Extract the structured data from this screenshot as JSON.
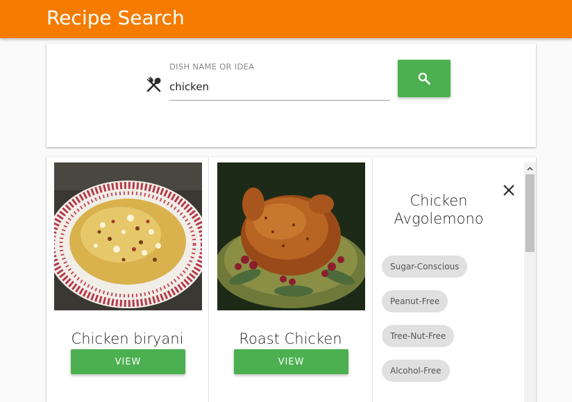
{
  "app": {
    "title": "Recipe Search",
    "accent_color": "#f57c00",
    "button_color": "#4caf50"
  },
  "search": {
    "label": "DISH NAME OR IDEA",
    "value": "chicken",
    "icon": "utensils-icon",
    "button_icon": "search-icon"
  },
  "results": [
    {
      "name": "Chicken biryani",
      "view_label": "VIEW",
      "image": "plate of chicken biryani rice"
    },
    {
      "name": "Roast Chicken",
      "view_label": "VIEW",
      "image": "whole roast chicken with grapes and herbs"
    }
  ],
  "detail": {
    "title": "Chicken Avgolemono",
    "close_icon": "close-icon",
    "tags": [
      "Sugar-Conscious",
      "Peanut-Free",
      "Tree-Nut-Free",
      "Alcohol-Free"
    ]
  }
}
